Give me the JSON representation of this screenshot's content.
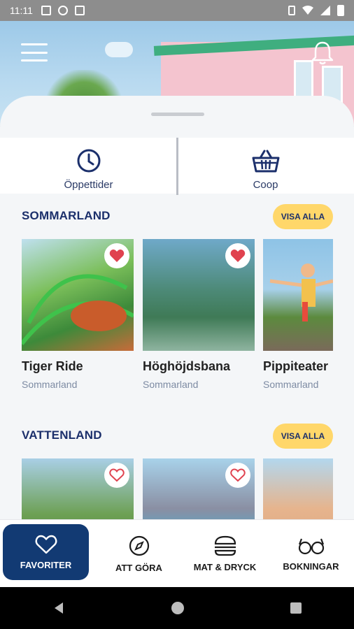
{
  "status_bar": {
    "time": "11:11"
  },
  "header": {
    "menu_icon": "hamburger-icon",
    "bell_icon": "bell-icon"
  },
  "quick_actions": [
    {
      "label": "Öppettider",
      "icon": "clock-icon"
    },
    {
      "label": "Coop",
      "icon": "basket-icon"
    }
  ],
  "sections": [
    {
      "title": "SOMMARLAND",
      "visa_alla": "VISA ALLA",
      "cards": [
        {
          "name": "Tiger Ride",
          "park": "Sommarland",
          "favorite": true
        },
        {
          "name": "Höghöjdsbana",
          "park": "Sommarland",
          "favorite": true
        },
        {
          "name": "Pippiteater",
          "park": "Sommarland",
          "favorite": false
        }
      ]
    },
    {
      "title": "VATTENLAND",
      "visa_alla": "VISA ALLA",
      "cards": [
        {
          "name": "",
          "park": "",
          "favorite": false
        },
        {
          "name": "",
          "park": "",
          "favorite": false
        },
        {
          "name": "",
          "park": "",
          "favorite": false
        }
      ]
    }
  ],
  "bottom_nav": [
    {
      "label": "FAVORITER",
      "icon": "heart-icon",
      "active": true
    },
    {
      "label": "ATT GÖRA",
      "icon": "compass-icon",
      "active": false
    },
    {
      "label": "MAT & DRYCK",
      "icon": "burger-icon",
      "active": false
    },
    {
      "label": "BOKNINGAR",
      "icon": "glasses-icon",
      "active": false
    }
  ],
  "colors": {
    "primary": "#123a73",
    "accent": "#ffd76a",
    "heart": "#e0424f"
  }
}
